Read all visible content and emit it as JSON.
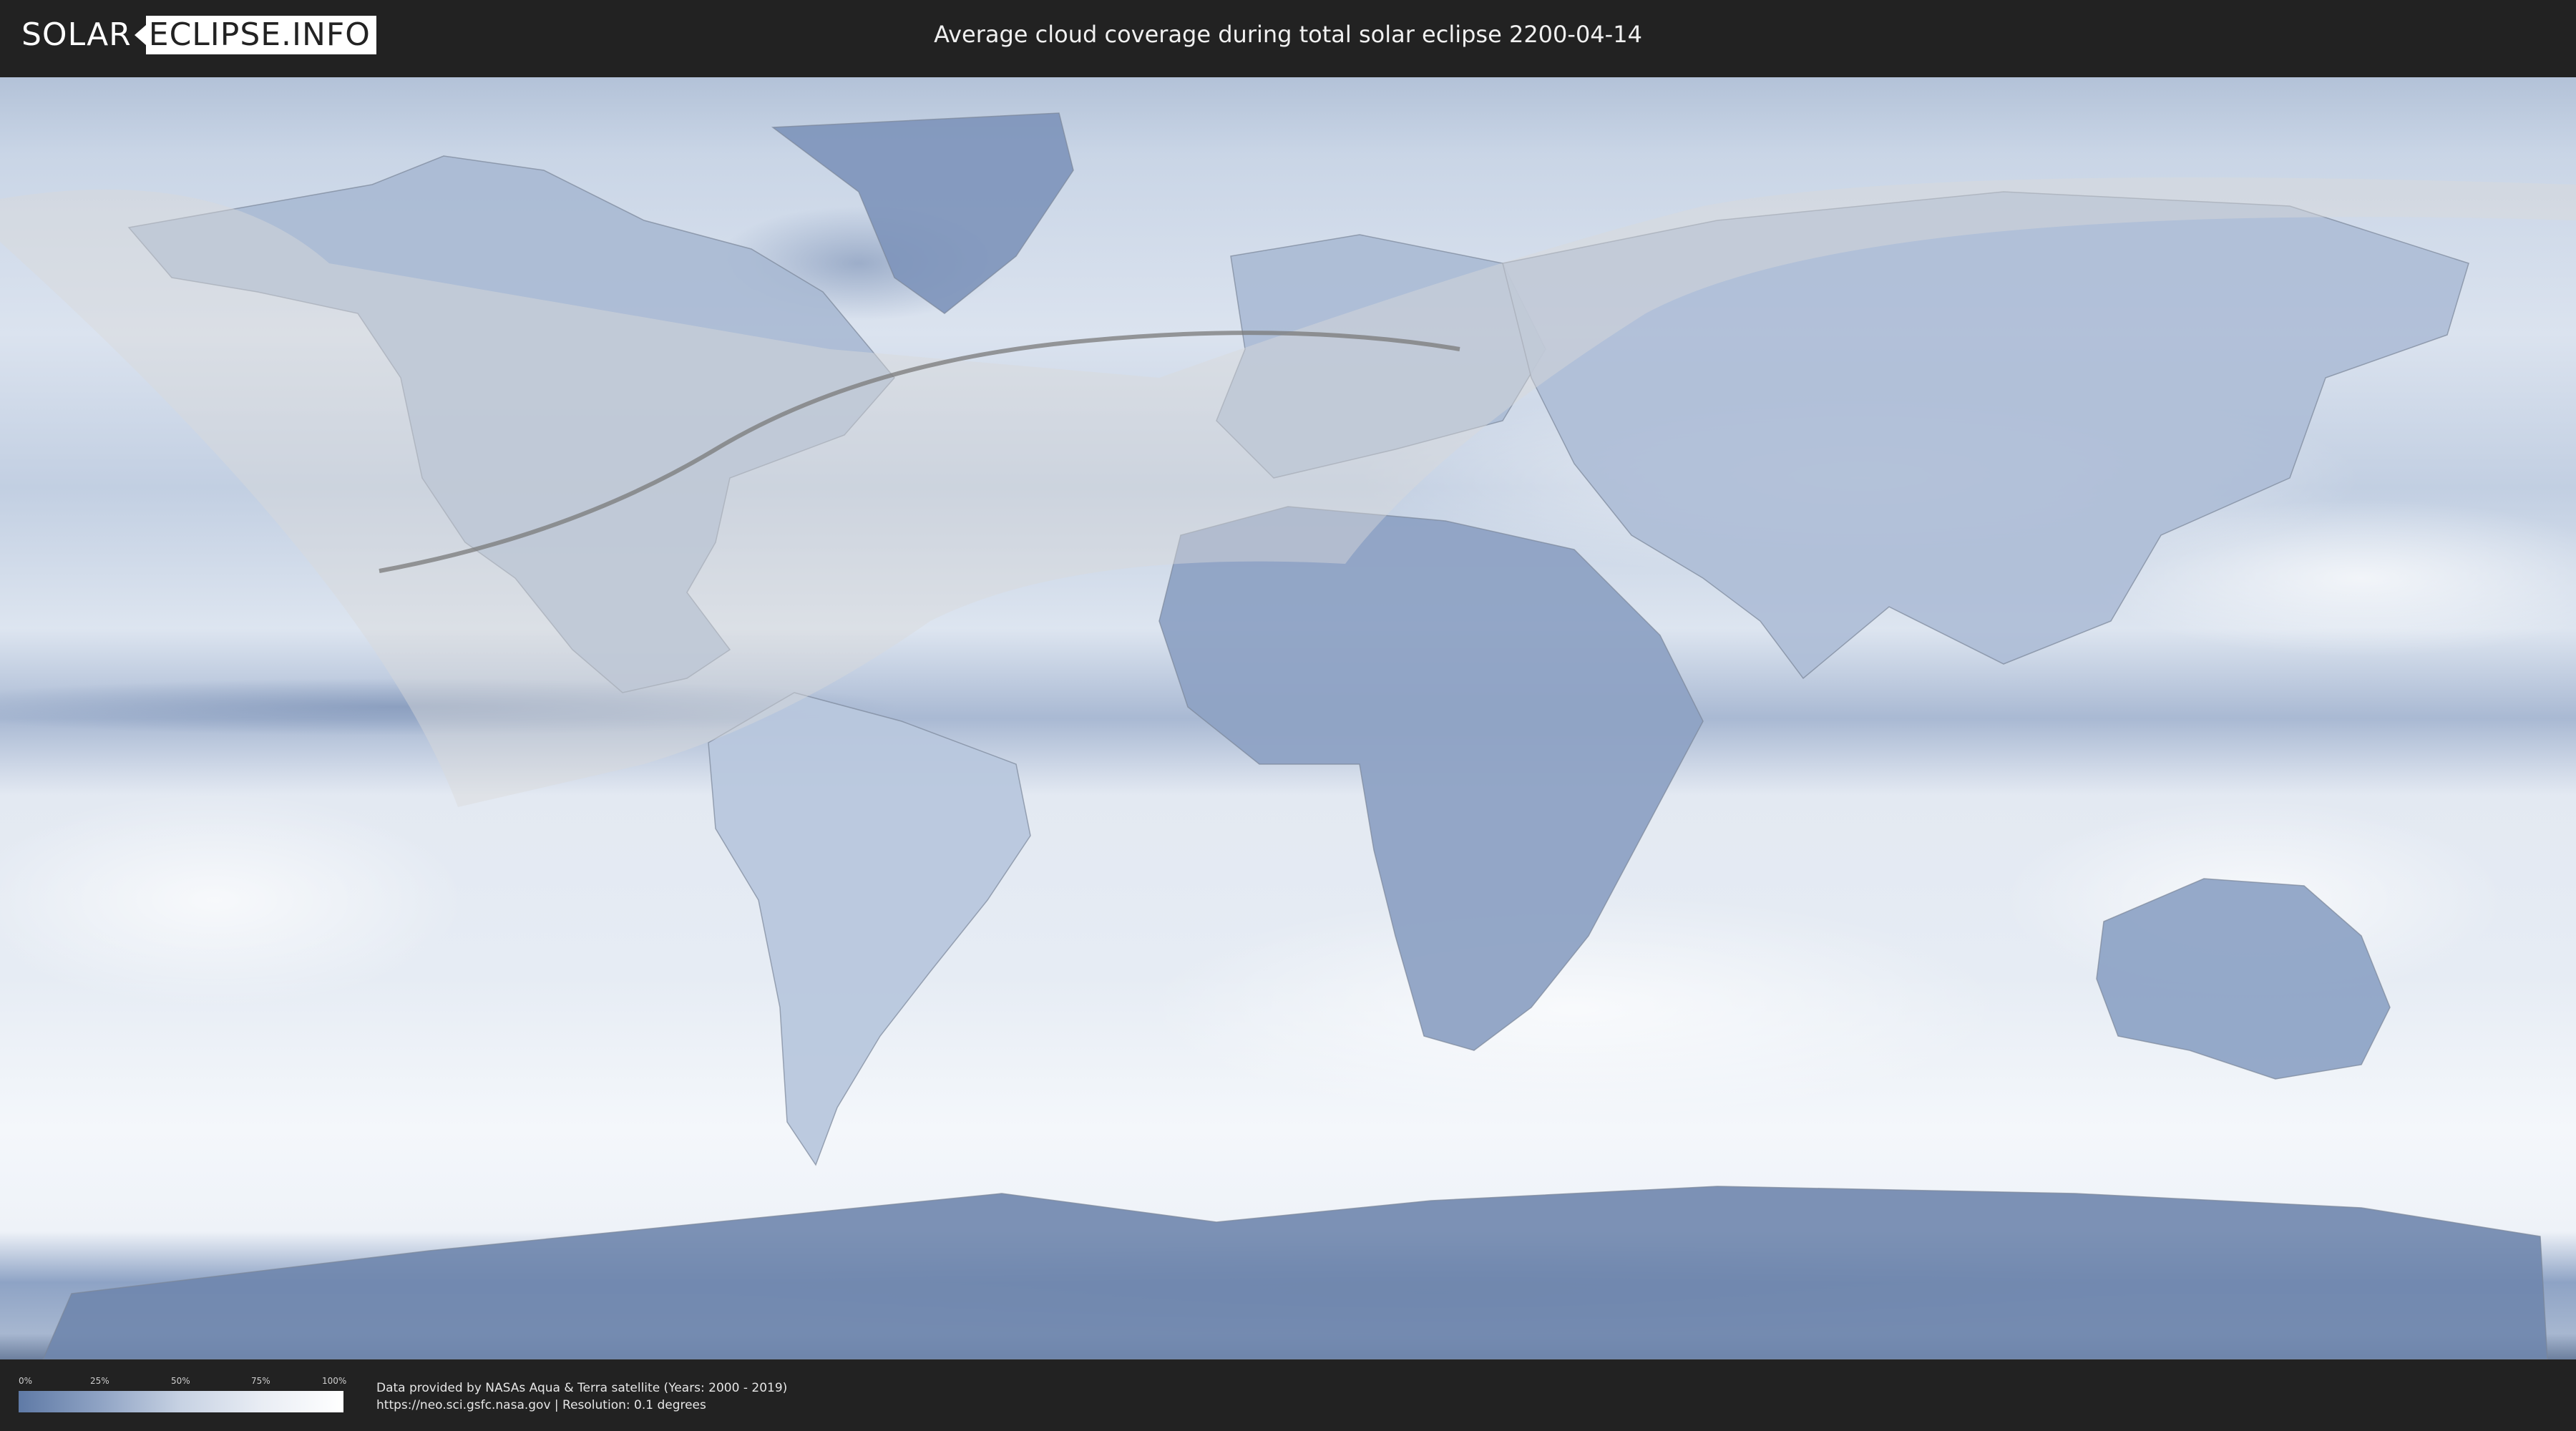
{
  "header": {
    "logo_solar": "SOLAR",
    "logo_eclipse": "ECLIPSE.INFO",
    "title": "Average cloud coverage during total solar eclipse 2200-04-14"
  },
  "legend": {
    "ticks": [
      "0%",
      "25%",
      "50%",
      "75%",
      "100%"
    ],
    "gradient_colors": [
      "#5f7aa6",
      "#8fa3c4",
      "#c7d2e3",
      "#e9edf4",
      "#ffffff"
    ]
  },
  "footer": {
    "credit_line1": "Data provided by NASAs Aqua & Terra satellite (Years: 2000 - 2019)",
    "credit_line2": "https://neo.sci.gsfc.nasa.gov | Resolution: 0.1 degrees"
  },
  "colors": {
    "background": "#222222",
    "ocean_clear": "#e8eef6",
    "cloud_dense": "#6f86ad",
    "eclipse_overlay": "#d9d9d9",
    "eclipse_path": "#7a7a7a"
  }
}
